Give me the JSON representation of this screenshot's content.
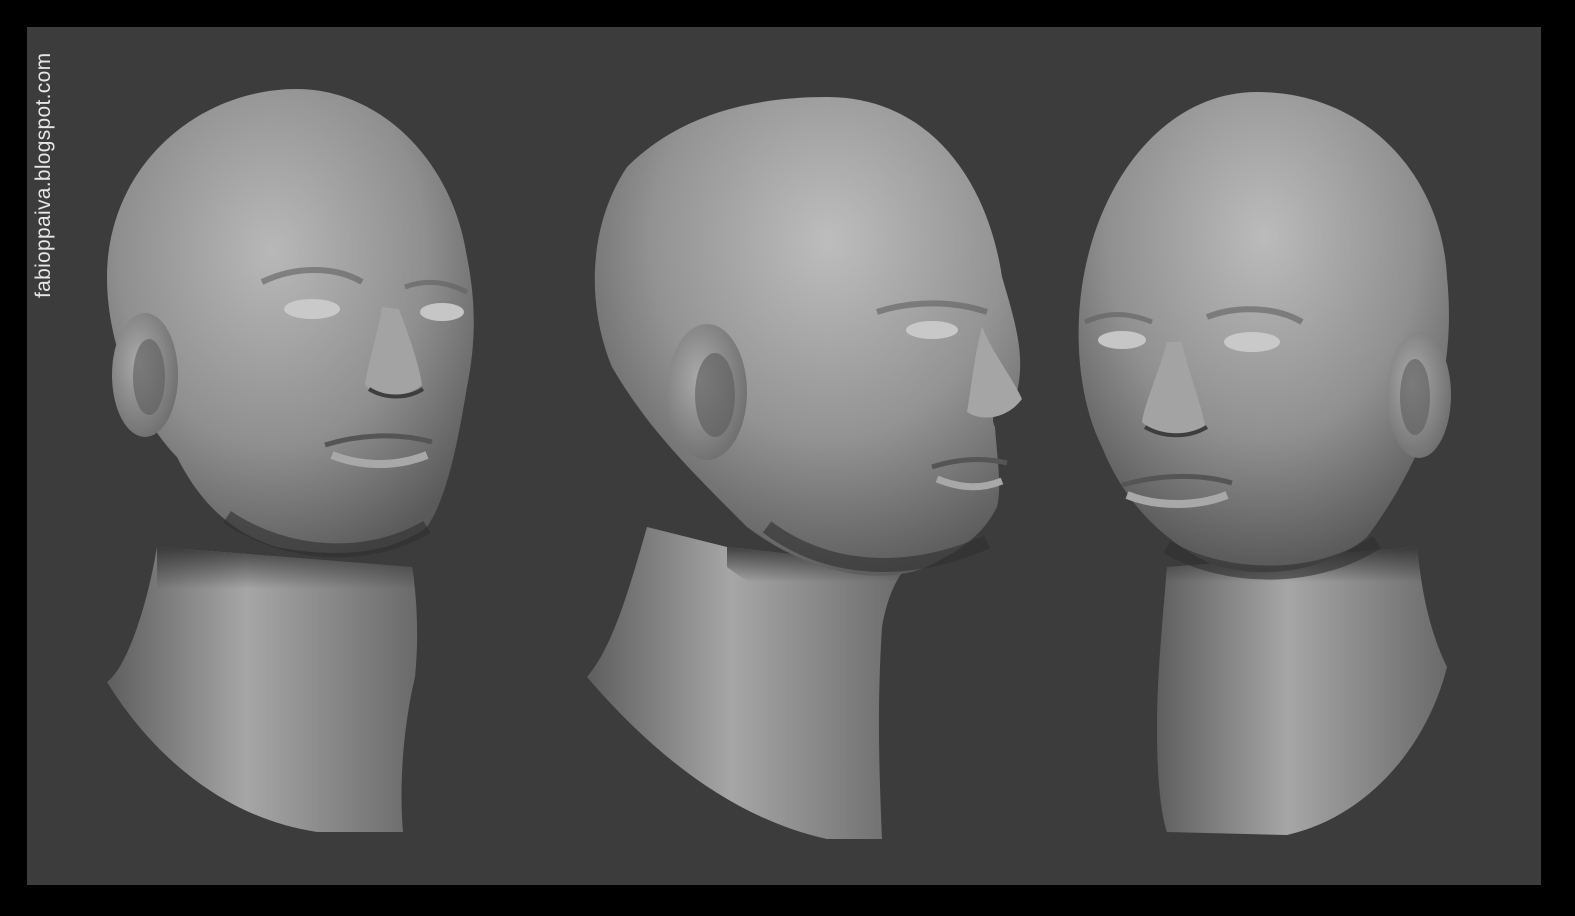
{
  "watermark": {
    "text": "fabioppaiva.blogspot.com"
  },
  "subject": {
    "views": [
      {
        "name": "three-quarter-left"
      },
      {
        "name": "profile-right"
      },
      {
        "name": "three-quarter-right"
      }
    ]
  },
  "colors": {
    "frame": "#000000",
    "background": "#3c3c3c",
    "clay_light": "#bdbdbd",
    "clay_mid": "#8e8e8e",
    "clay_dark": "#4a4a4a",
    "watermark": "#e6e6e6"
  }
}
